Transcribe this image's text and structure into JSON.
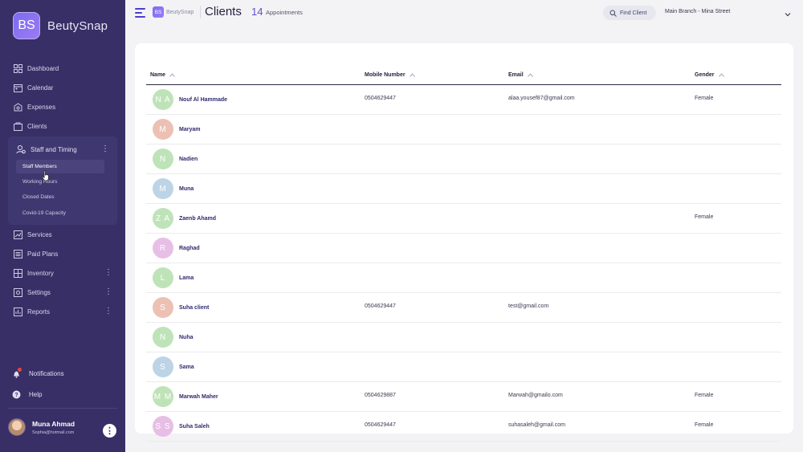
{
  "brand": {
    "logo": "BS",
    "name": "BeutySnap"
  },
  "sidebar": {
    "items": [
      {
        "label": "Dashboard",
        "icon": "dashboard-icon"
      },
      {
        "label": "Calendar",
        "icon": "calendar-icon"
      },
      {
        "label": "Expenses",
        "icon": "expenses-icon"
      },
      {
        "label": "Clients",
        "icon": "clients-icon"
      }
    ],
    "group": {
      "label": "Staff and Timing",
      "icon": "staff-icon",
      "subitems": [
        "Staff Members",
        "Working Hours",
        "Closed Dates",
        "Covid-19 Capacity"
      ],
      "active": "Staff Members"
    },
    "items_after": [
      {
        "label": "Services",
        "icon": "services-icon",
        "more": false
      },
      {
        "label": "Paid Plans",
        "icon": "paid-plans-icon",
        "more": false
      },
      {
        "label": "Inventory",
        "icon": "inventory-icon",
        "more": true
      },
      {
        "label": "Settings",
        "icon": "settings-icon",
        "more": true
      },
      {
        "label": "Reports",
        "icon": "reports-icon",
        "more": true
      }
    ],
    "notifications": "Notifications",
    "help": "Help",
    "user": {
      "name": "Muna Ahmad",
      "email": "Sophia@hotmail.com"
    }
  },
  "topbar": {
    "mini_logo": "BS",
    "mini_name": "BeutySnap",
    "title": "Clients",
    "appointments_count": "14",
    "appointments_label": "Appointments",
    "find_client": "Find Client",
    "branch": "Main Branch - Mina Street"
  },
  "table": {
    "columns": [
      "Name",
      "Mobile Number",
      "Email",
      "Gender"
    ],
    "rows": [
      {
        "initials": "N A",
        "name": "Nouf Al Hammade",
        "mobile": "0504629447",
        "email": "alaa.yousef87@gmail.com",
        "gender": "Female",
        "color": "#bfe3b8"
      },
      {
        "initials": "M",
        "name": "Maryam",
        "mobile": "",
        "email": "",
        "gender": "",
        "color": "#ecc1b3"
      },
      {
        "initials": "N",
        "name": "Nadien",
        "mobile": "",
        "email": "",
        "gender": "",
        "color": "#bfe3b8"
      },
      {
        "initials": "M",
        "name": "Muna",
        "mobile": "",
        "email": "",
        "gender": "",
        "color": "#bcd4e6"
      },
      {
        "initials": "Z A",
        "name": "Zaenb Ahamd",
        "mobile": "",
        "email": "",
        "gender": "Female",
        "color": "#bfe3b8"
      },
      {
        "initials": "R",
        "name": "Raghad",
        "mobile": "",
        "email": "",
        "gender": "",
        "color": "#e7bfe6"
      },
      {
        "initials": "L",
        "name": "Lama",
        "mobile": "",
        "email": "",
        "gender": "",
        "color": "#bfe3b8"
      },
      {
        "initials": "S",
        "name": "Suha client",
        "mobile": "0504629447",
        "email": "test@gmail.com",
        "gender": "",
        "color": "#ecc1b3"
      },
      {
        "initials": "N",
        "name": "Nuha",
        "mobile": "",
        "email": "",
        "gender": "",
        "color": "#bfe3b8"
      },
      {
        "initials": "S",
        "name": "Sama",
        "mobile": "",
        "email": "",
        "gender": "",
        "color": "#bcd4e6"
      },
      {
        "initials": "M M",
        "name": "Marwah Maher",
        "mobile": "0504629887",
        "email": "Marwah@gmailo.com",
        "gender": "Female",
        "color": "#bfe3b8"
      },
      {
        "initials": "S S",
        "name": "Suha Saleh",
        "mobile": "0504629447",
        "email": "suhasaleh@gmail.com",
        "gender": "Female",
        "color": "#e7bfe6"
      }
    ]
  }
}
